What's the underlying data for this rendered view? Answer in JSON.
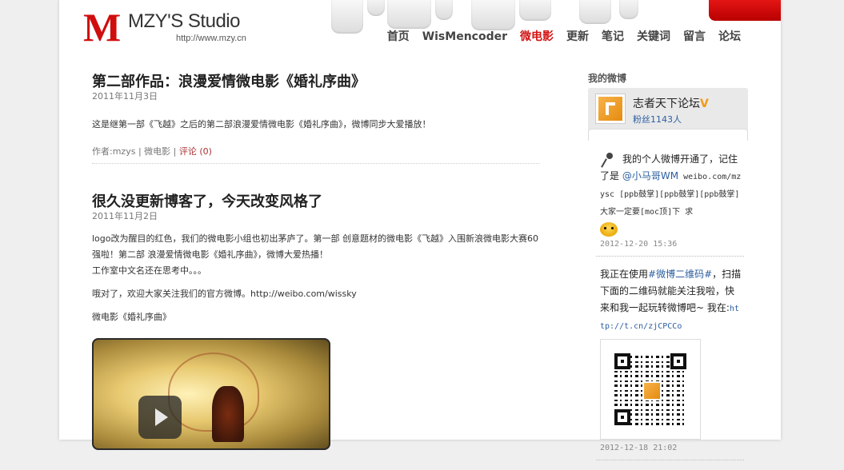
{
  "site": {
    "logo_letter": "M",
    "title": "MZY'S Studio",
    "url": "http://www.mzy.cn"
  },
  "nav": [
    {
      "label": "首页",
      "active": false
    },
    {
      "label": "WisMencoder",
      "active": false
    },
    {
      "label": "微电影",
      "active": true
    },
    {
      "label": "更新",
      "active": false
    },
    {
      "label": "笔记",
      "active": false
    },
    {
      "label": "关键词",
      "active": false
    },
    {
      "label": "留言",
      "active": false
    },
    {
      "label": "论坛",
      "active": false
    }
  ],
  "posts": [
    {
      "title": "第二部作品：浪漫爱情微电影《婚礼序曲》",
      "date": "2011年11月3日",
      "body": [
        "这是继第一部《飞越》之后的第二部浪漫爱情微电影《婚礼序曲》，微博同步大爱播放！"
      ],
      "author_label": "作者:mzys",
      "category": "微电影",
      "comments": "评论 (0)"
    },
    {
      "title": "很久没更新博客了，今天改变风格了",
      "date": "2011年11月2日",
      "body": [
        "logo改为醒目的红色，我们的微电影小组也初出茅庐了。第一部 创意题材的微电影《飞越》入围新浪微电影大赛60强啦！第二部 浪漫爱情微电影《婚礼序曲》，微博大爱热播！",
        "工作室中文名还在思考中。。。",
        "哦对了，欢迎大家关注我们的官方微博。http://weibo.com/wissky",
        "微电影《婚礼序曲》"
      ]
    }
  ],
  "sidebar": {
    "heading": "我的微博",
    "weibo_name": "志者天下论坛",
    "weibo_v": "V",
    "fans": "粉丝1143人",
    "feed": [
      {
        "text_prefix": "我的个人微博开通了，记住了是 ",
        "mention": "@小马哥WM",
        "text_mono": " weibo.com/mzysc [ppb鼓掌][ppb鼓掌][ppb鼓掌] 大家一定要[moc顶]下 求",
        "time": "2012-12-20 15:36"
      },
      {
        "text_prefix": "我正在使用",
        "hashtag": "#微博二维码#",
        "text_mid": "，扫描下面的二维码就能关注我啦，快来和我一起玩转微博吧~ 我在:",
        "link": "http://t.cn/zjCPCCo",
        "time": "2012-12-18 21:02"
      }
    ]
  },
  "colors": {
    "accent_red": "#d31414",
    "link_blue": "#2c5ea0"
  }
}
